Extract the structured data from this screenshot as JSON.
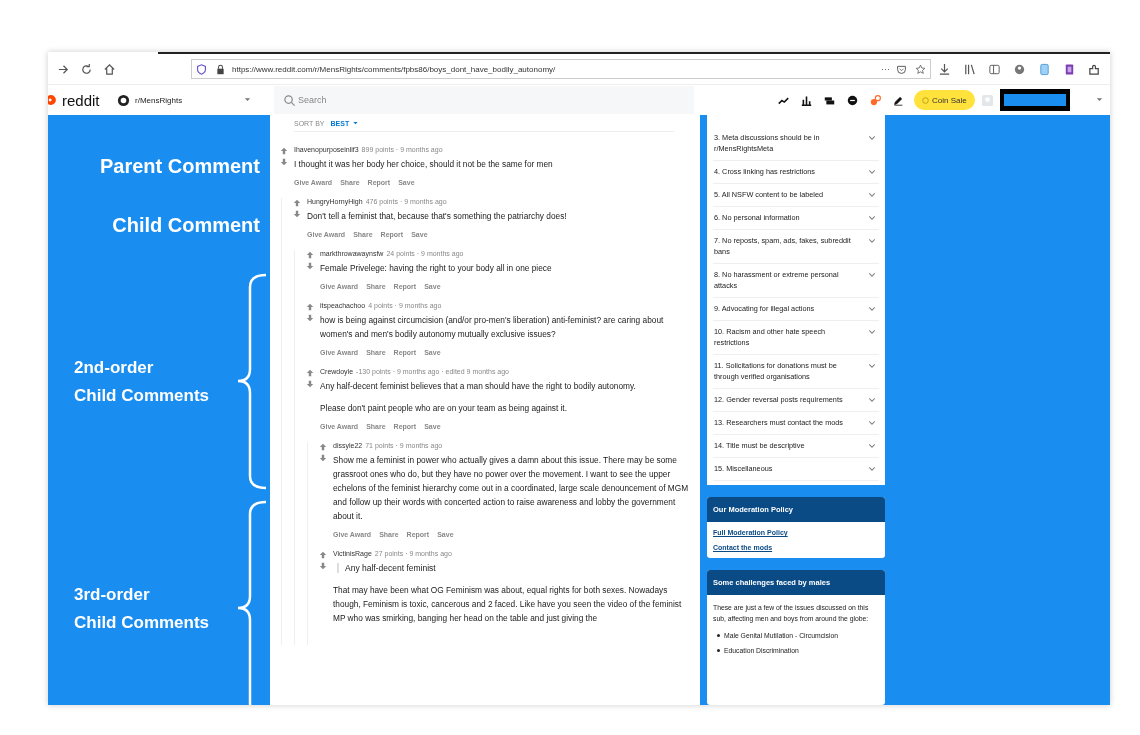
{
  "browser": {
    "url": "https://www.reddit.com/r/MensRights/comments/fpbs86/boys_dont_have_bodily_autonomy/",
    "more": "···"
  },
  "header": {
    "logo": "reddit",
    "community": "r/MensRights",
    "search_placeholder": "Search",
    "coin_button": "Coin Sale"
  },
  "annotations": [
    {
      "kind": "label",
      "lines": [
        "Parent Comment"
      ]
    },
    {
      "kind": "label",
      "lines": [
        "Child Comment"
      ]
    },
    {
      "kind": "bracket",
      "lines": [
        "2nd-order",
        "Child Comments"
      ]
    },
    {
      "kind": "bracket",
      "lines": [
        "3rd-order",
        "Child Comments"
      ]
    }
  ],
  "sort": {
    "label": "SORT BY",
    "value": "BEST"
  },
  "comments": [
    {
      "author": "Ihavenopurposeinlif3",
      "meta": "899 points · 9 months ago",
      "body": [
        "I thought it was her body her choice, should it not be the same for men"
      ],
      "actions": [
        "Give Award",
        "Share",
        "Report",
        "Save"
      ],
      "children": [
        {
          "author": "HungryHornyHigh",
          "meta": "476 points · 9 months ago",
          "body": [
            "Don't tell a feminist that, because that's something the patriarchy does!"
          ],
          "actions": [
            "Give Award",
            "Share",
            "Report",
            "Save"
          ],
          "children": [
            {
              "author": "markthrowawaynsfw",
              "meta": "24 points · 9 months ago",
              "body": [
                "Female Privelege: having the right to your body all in one piece"
              ],
              "actions": [
                "Give Award",
                "Share",
                "Report",
                "Save"
              ]
            },
            {
              "author": "itspeachachoo",
              "meta": "4 points · 9 months ago",
              "body": [
                "how is being against circumcision (and/or pro-men's liberation) anti-feminist? are caring about women's and men's bodily autonomy mutually exclusive issues?"
              ],
              "actions": [
                "Give Award",
                "Share",
                "Report",
                "Save"
              ]
            },
            {
              "author": "Crewdoyle",
              "meta": "-130 points · 9 months ago · edited 9 months ago",
              "body": [
                "Any half-decent feminist believes that a man should have the right to bodily autonomy.",
                "Please don't paint people who are on your team as being against it."
              ],
              "actions": [
                "Give Award",
                "Share",
                "Report",
                "Save"
              ],
              "children": [
                {
                  "author": "dissyle22",
                  "meta": "71 points · 9 months ago",
                  "body": [
                    "Show me a feminist in power who actually gives a damn about this issue. There may be some grassroot ones who do, but they have no power over the movement. I want to see the upper echelons of the feminist hierarchy come out in a coordinated, large scale denouncement of MGM and follow up their words with concerted action to raise awareness and lobby the government about it."
                  ],
                  "actions": [
                    "Give Award",
                    "Share",
                    "Report",
                    "Save"
                  ]
                },
                {
                  "author": "VictinisRage",
                  "meta": "27 points · 9 months ago",
                  "quote": "Any half-decent feminist",
                  "body": [
                    "That may have been what OG Feminism was about, equal rights for both sexes. Nowadays though, Feminism is toxic, cancerous and 2 faced. Like have you seen the video of the feminist MP who was smirking, banging her head on the table and just giving the"
                  ]
                }
              ]
            }
          ]
        }
      ]
    }
  ],
  "rules": [
    "3. Meta discussions should be in r/MensRightsMeta",
    "4. Cross linking has restrictions",
    "5. All NSFW content to be labeled",
    "6. No personal information",
    "7. No reposts, spam, ads, fakes, subreddit bans",
    "8. No harassment or extreme personal attacks",
    "9. Advocating for illegal actions",
    "10. Racism and other hate speech restrictions",
    "11. Solicitations for donations must be through verified organisations",
    "12. Gender reversal posts requirements",
    "13. Researchers must contact the mods",
    "14. Title must be descriptive",
    "15. Miscellaneous"
  ],
  "moderation": {
    "title": "Our Moderation Policy",
    "links": [
      "Full Moderation Policy",
      "Contact the mods"
    ]
  },
  "challenges": {
    "title": "Some challenges faced by males",
    "intro": "These are just a few of the issues discussed on this sub, affecting men and boys from around the globe:",
    "items": [
      "Male Genital Mutilation - Circumcision",
      "Education Discrimination"
    ]
  }
}
